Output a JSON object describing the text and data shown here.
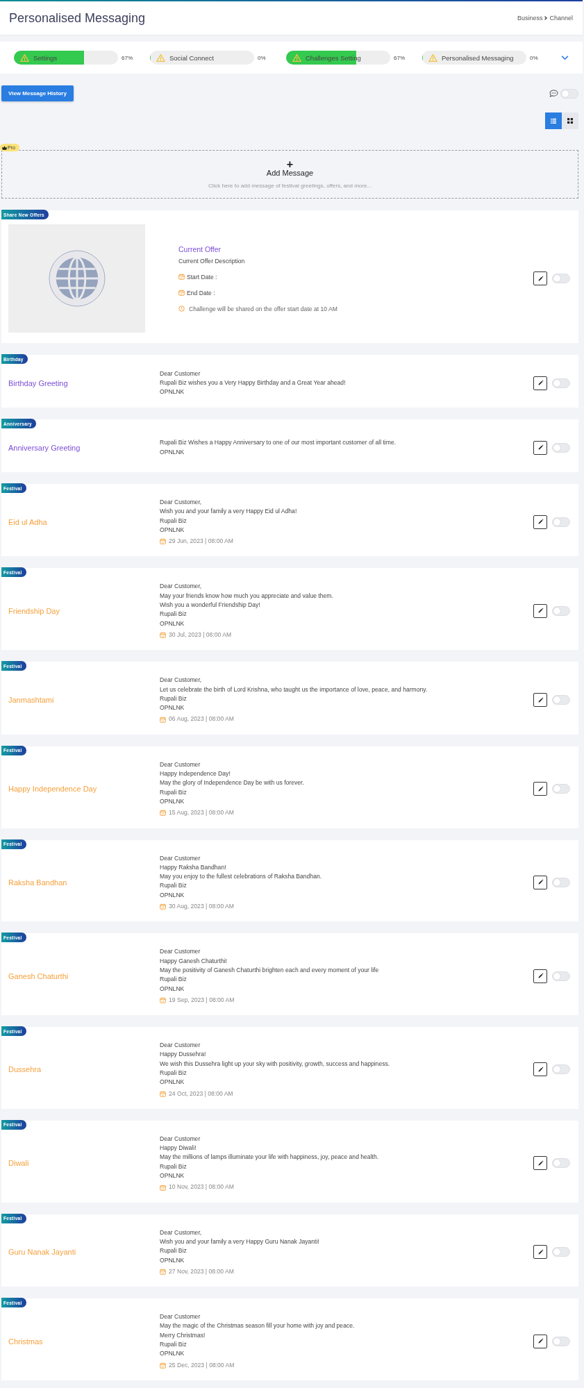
{
  "header": {
    "title": "Personalised Messaging",
    "breadcrumb": [
      "Business",
      "Channel"
    ]
  },
  "progress": [
    {
      "label": "Settings",
      "level": 0.67,
      "percent": "67%"
    },
    {
      "label": "Social Connect",
      "level": 0,
      "percent": "0%"
    },
    {
      "label": "Challenges Setting",
      "level": 0.67,
      "percent": "67%"
    },
    {
      "label": "Personalised Messaging",
      "level": 0,
      "percent": "0%"
    }
  ],
  "history_button": "View Message History",
  "chat_toggle": {
    "on": false
  },
  "views": [
    {
      "kind": "list",
      "selected": true
    },
    {
      "kind": "grid",
      "selected": false
    }
  ],
  "add_message": {
    "badge": "Pro",
    "plus": "+",
    "title": "Add Message",
    "hint": "Click here to add message of festival greetings, offers, and more..."
  },
  "offer": {
    "tag": "Share New Offers",
    "title": "Current Offer",
    "description": "Current Offer Description",
    "start": "Start Date :",
    "end": "End Date :",
    "note": "Challenge will be shared on the offer start date at 10 AM",
    "enabled": false
  },
  "messages": [
    {
      "tag": "Birthday",
      "kind": "greeting",
      "title": "Birthday Greeting",
      "lines": [
        "Dear Customer",
        "Rupali Biz wishes you a Very Happy Birthday and a Great Year ahead!",
        "OPNLNK"
      ],
      "enabled": false
    },
    {
      "tag": "Anniversary",
      "kind": "greeting",
      "title": "Anniversary Greeting",
      "lines": [
        "Rupali Biz Wishes a Happy Anniversary to one of our most important customer of all time.",
        "OPNLNK"
      ],
      "enabled": false
    },
    {
      "tag": "Festival",
      "kind": "festival",
      "title": "Eid ul Adha",
      "lines": [
        "Dear Customer,",
        "Wish you and your family a very Happy Eid ul Adha!",
        "Rupali Biz",
        "OPNLNK"
      ],
      "date": "29 Jun, 2023 | 08:00 AM",
      "enabled": false
    },
    {
      "tag": "Festival",
      "kind": "festival",
      "title": "Friendship Day",
      "lines": [
        "Dear Customer,",
        "May your friends know how much you appreciate and value them.",
        "Wish you a wonderful Friendship Day!",
        "Rupali Biz",
        "OPNLNK"
      ],
      "date": "30 Jul, 2023 | 08:00 AM",
      "enabled": false
    },
    {
      "tag": "Festival",
      "kind": "festival",
      "title": "Janmashtami",
      "lines": [
        "Dear Customer,",
        "Let us celebrate the birth of Lord Krishna, who taught us the importance of love, peace, and harmony.",
        "Rupali Biz",
        "OPNLNK"
      ],
      "date": "06 Aug, 2023 | 08:00 AM",
      "enabled": false
    },
    {
      "tag": "Festival",
      "kind": "festival",
      "title": "Happy Independence Day",
      "lines": [
        "Dear Customer",
        "Happy Independence Day!",
        "May the glory of Independence Day be with us forever.",
        "Rupali Biz",
        "OPNLNK"
      ],
      "date": "15 Aug, 2023 | 08:00 AM",
      "enabled": false
    },
    {
      "tag": "Festival",
      "kind": "festival",
      "title": "Raksha Bandhan",
      "lines": [
        "Dear Customer",
        "Happy Raksha Bandhan!",
        "May you enjoy to the fullest celebrations of Raksha Bandhan.",
        "Rupali Biz",
        "OPNLNK"
      ],
      "date": "30 Aug, 2023 | 08:00 AM",
      "enabled": false
    },
    {
      "tag": "Festival",
      "kind": "festival",
      "title": "Ganesh Chaturthi",
      "lines": [
        "Dear Customer",
        "Happy Ganesh Chaturthi!",
        "May the positivity of Ganesh Chaturthi brighten each and every moment of your life",
        "Rupali Biz",
        "OPNLNK"
      ],
      "date": "19 Sep, 2023 | 08:00 AM",
      "enabled": false
    },
    {
      "tag": "Festival",
      "kind": "festival",
      "title": "Dussehra",
      "lines": [
        "Dear Customer",
        "Happy Dussehra!",
        "We wish this Dussehra light up your sky with positivity, growth, success and happiness.",
        "Rupali Biz",
        "OPNLNK"
      ],
      "date": "24 Oct, 2023 | 08:00 AM",
      "enabled": false
    },
    {
      "tag": "Festival",
      "kind": "festival",
      "title": "Diwali",
      "lines": [
        "Dear Customer",
        "Happy Diwali!",
        "May the millions of lamps illuminate your life with happiness, joy, peace and health.",
        "Rupali Biz",
        "OPNLNK"
      ],
      "date": "10 Nov, 2023 | 08:00 AM",
      "enabled": false
    },
    {
      "tag": "Festival",
      "kind": "festival",
      "title": "Guru Nanak Jayanti",
      "lines": [
        "Dear Customer,",
        "Wish you and your family a very Happy Guru Nanak Jayanti!",
        "Rupali Biz",
        "OPNLNK"
      ],
      "date": "27 Nov, 2023 | 08:00 AM",
      "enabled": false
    },
    {
      "tag": "Festival",
      "kind": "festival",
      "title": "Christmas",
      "lines": [
        "Dear Customer",
        "May the magic of the Christmas season fill your home with joy and peace.",
        "Merry Christmas!",
        "Rupali Biz",
        "OPNLNK"
      ],
      "date": "25 Dec, 2023 | 08:00 AM",
      "enabled": false
    }
  ]
}
